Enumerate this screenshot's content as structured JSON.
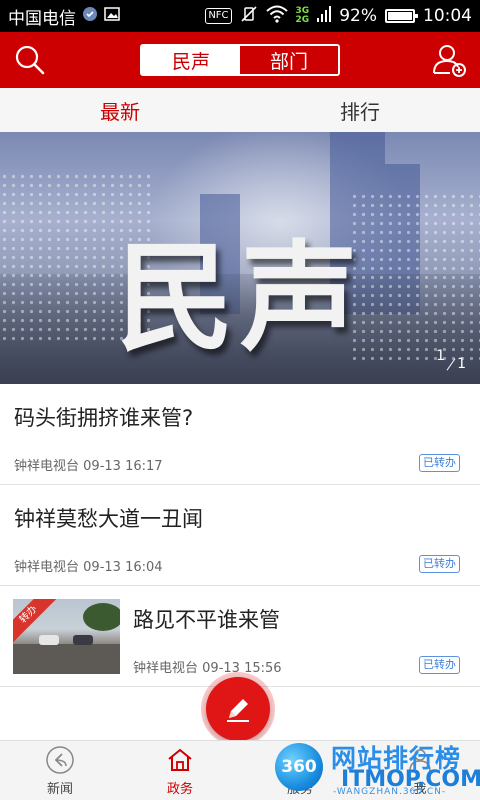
{
  "status_bar": {
    "carrier": "中国电信",
    "network_top": "3G",
    "network_bottom": "2G",
    "nfc_label": "NFC",
    "battery_text": "92%",
    "battery_level": 0.92,
    "time": "10:04"
  },
  "header": {
    "segments": [
      {
        "label": "民声",
        "active": true
      },
      {
        "label": "部门",
        "active": false
      }
    ],
    "left_icon": "search-icon",
    "right_icon": "user-group-icon",
    "accent_color": "#cc0000"
  },
  "tabs": [
    {
      "label": "最新",
      "active": true
    },
    {
      "label": "排行",
      "active": false
    }
  ],
  "banner": {
    "title": "民声",
    "counter_current": "1",
    "counter_total": "1"
  },
  "news": [
    {
      "title": "码头街拥挤谁来管?",
      "source": "钟祥电视台",
      "time": "09-13 16:17",
      "status": "已转办",
      "has_thumb": false
    },
    {
      "title": "钟祥莫愁大道一丑闻",
      "source": "钟祥电视台",
      "time": "09-13 16:04",
      "status": "已转办",
      "has_thumb": false
    },
    {
      "title": "路见不平谁来管",
      "source": "钟祥电视台",
      "time": "09-13 15:56",
      "status": "已转办",
      "has_thumb": true,
      "thumb_ribbon": "转办"
    }
  ],
  "fab": {
    "icon": "pencil-icon"
  },
  "bottom_nav": [
    {
      "label": "新闻",
      "icon": "back-circle-icon",
      "active": false
    },
    {
      "label": "政务",
      "icon": "home-icon",
      "active": true
    },
    {
      "label": "服务",
      "icon": "chat-icon",
      "active": false
    },
    {
      "label": "我",
      "icon": "user-icon",
      "active": false
    }
  ],
  "watermark": {
    "logo": "360",
    "text": "网站排行榜",
    "brand": "ITMOP.COM",
    "url": "-WANGZHAN.360.CN-"
  }
}
